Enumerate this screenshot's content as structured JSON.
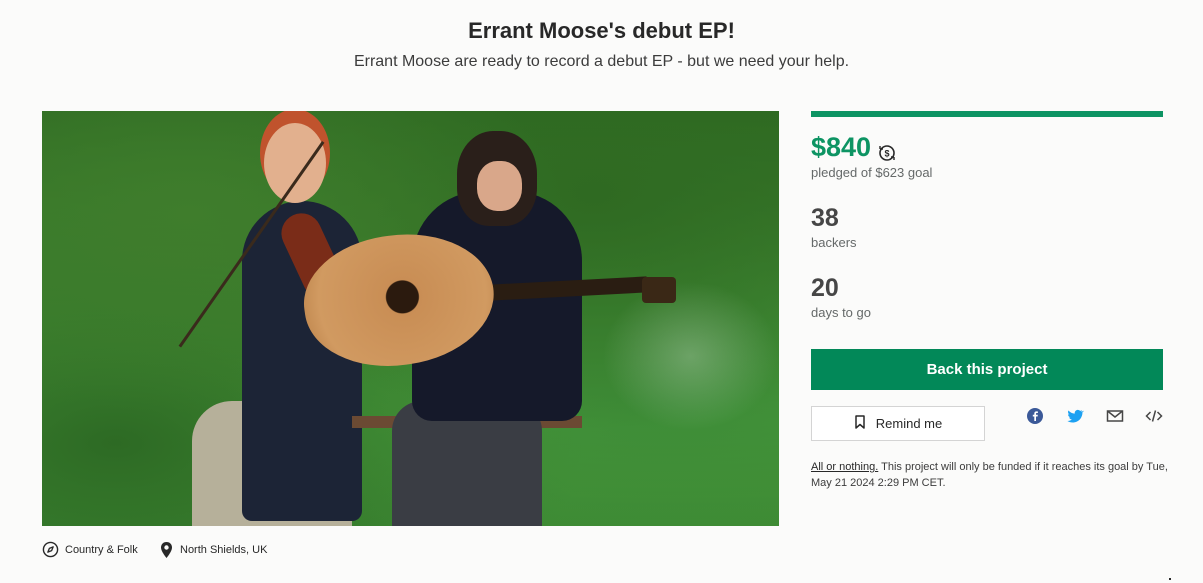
{
  "project": {
    "title": "Errant Moose's debut EP!",
    "subtitle": "Errant Moose are ready to record a debut EP - but we need your help."
  },
  "hero_image": {
    "description": "Two musicians seated on a bench in greenery, one playing violin and one playing acoustic guitar"
  },
  "stats": {
    "pledged": "$840",
    "pledged_label": "pledged of $623 goal",
    "progress_percent": 100,
    "backers": "38",
    "backers_label": "backers",
    "days": "20",
    "days_label": "days to go"
  },
  "actions": {
    "back_label": "Back this project",
    "remind_label": "Remind me"
  },
  "share": {
    "icons": [
      "facebook-icon",
      "twitter-icon",
      "email-icon",
      "embed-icon"
    ]
  },
  "disclaimer": {
    "all_or_nothing": "All or nothing.",
    "text": " This project will only be funded if it reaches its goal by Tue, May 21 2024 2:29 PM CET."
  },
  "meta": {
    "category": "Country & Folk",
    "location": "North Shields, UK"
  },
  "colors": {
    "accent": "#028858",
    "pledged_text": "#0d9463"
  }
}
